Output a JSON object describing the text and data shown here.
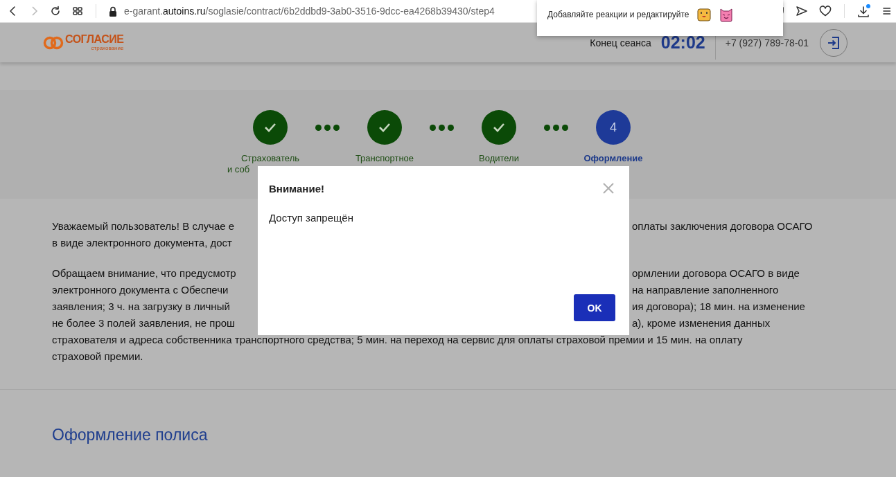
{
  "browser": {
    "url": "e-garant.**autoins.ru**/soglasie/contract/6b2ddbd9-3ab0-3516-9dcc-ea4268b39430/step4",
    "popup": {
      "text": "Добавляйте реакции и редактируйте"
    }
  },
  "header": {
    "logo": {
      "name": "СОГЛАСИЕ",
      "subtitle": "страхование"
    },
    "session_label": "Конец сеанса",
    "timer": "02:02",
    "phone": "+7 (927) 789-78-01"
  },
  "stepper": {
    "steps": [
      {
        "completed": true,
        "selected": false,
        "lines": [
          "Страхователь",
          "и соб"
        ]
      },
      {
        "completed": true,
        "selected": false,
        "lines": [
          "Транспортное"
        ]
      },
      {
        "completed": true,
        "selected": false,
        "lines": [
          "Водители"
        ]
      },
      {
        "completed": false,
        "selected": true,
        "number": "4",
        "lines": [
          "Оформление"
        ]
      }
    ]
  },
  "notice": {
    "paragraphs": [
      {
        "lines": [
          {
            "kind": "split",
            "left": "Уважаемый пользователь! В случае е",
            "right": "оплаты заключения договора ОСАГО"
          },
          {
            "kind": "split",
            "left": "в виде электронного документа, дост"
          }
        ]
      },
      {
        "lines": [
          {
            "kind": "split",
            "left": "Обращаем внимание, что предусмотр",
            "right": "ормлении договора ОСАГО в виде"
          },
          {
            "kind": "split",
            "left": "электронного документа с Обеспечи",
            "right": "на направление заполненного"
          },
          {
            "kind": "split",
            "left": "заявления; 3 ч. на загрузку в личный",
            "right": "ия договора); 18 мин. на изменение"
          },
          {
            "kind": "split",
            "left": "не более 3 полей заявления, не прош",
            "right": "а), кроме изменения данных"
          },
          {
            "kind": "full",
            "text": "страхователя и адреса собственника транспортного средства; 5 мин. на переход на сервис для оплаты страховой премии и 15 мин. на оплату"
          },
          {
            "kind": "full",
            "text": "страховой премии."
          }
        ]
      }
    ]
  },
  "section_title": "Оформление полиса",
  "modal": {
    "title": "Внимание!",
    "message": "Доступ запрещён",
    "ok": "OK"
  }
}
